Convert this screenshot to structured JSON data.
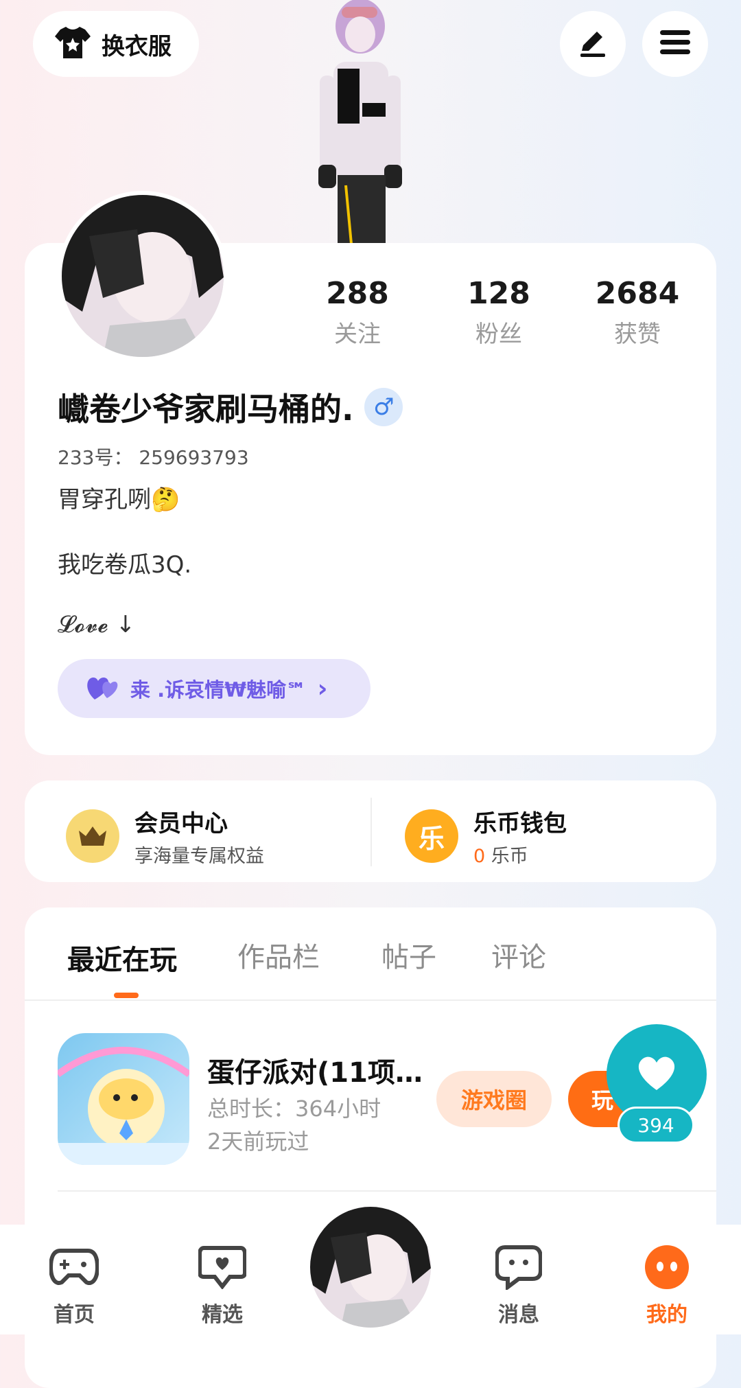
{
  "header": {
    "outfit_label": "换衣服",
    "outfit_icon": "tshirt-icon",
    "edit_icon": "pencil-icon",
    "menu_icon": "hamburger-menu-icon"
  },
  "profile": {
    "stats": [
      {
        "value": "288",
        "label": "关注"
      },
      {
        "value": "128",
        "label": "粉丝"
      },
      {
        "value": "2684",
        "label": "获赞"
      }
    ],
    "username": "巇卷少爷家刷马桶的.",
    "gender_symbol": "♂",
    "id_line": "233号： 259693793",
    "bio_lines": [
      "胃穿孔咧🤔",
      "我吃卷瓜3Q.",
      "𝓛𝓸𝓿𝓮 ↓"
    ],
    "guard_text": "𥸮 .诉哀情₩魅喻℠",
    "guard_chevron": "›"
  },
  "member": {
    "title": "会员中心",
    "subtitle": "享海量专属权益"
  },
  "wallet": {
    "title": "乐币钱包",
    "amount": "0",
    "unit": "乐币",
    "coin_char": "乐"
  },
  "tabs": [
    {
      "label": "最近在玩",
      "active": true
    },
    {
      "label": "作品栏",
      "active": false
    },
    {
      "label": "帖子",
      "active": false
    },
    {
      "label": "评论",
      "active": false
    }
  ],
  "game": {
    "title": "蛋仔派对(11项…",
    "total_time": "总时长：364小时",
    "last_played": "2天前玩过",
    "circle_button": "游戏圈",
    "play_button": "玩"
  },
  "like_fab": {
    "count": "394"
  },
  "bottom_nav": [
    {
      "label": "首页",
      "icon": "gamepad-icon"
    },
    {
      "label": "精选",
      "icon": "heart-chat-icon"
    },
    {
      "label": "",
      "icon": "avatar"
    },
    {
      "label": "消息",
      "icon": "message-icon"
    },
    {
      "label": "我的",
      "icon": "me-face-icon",
      "active": true
    }
  ],
  "colors": {
    "accent": "#ff6a1a",
    "like": "#16b6c4",
    "guard": "#6f5ce6"
  }
}
